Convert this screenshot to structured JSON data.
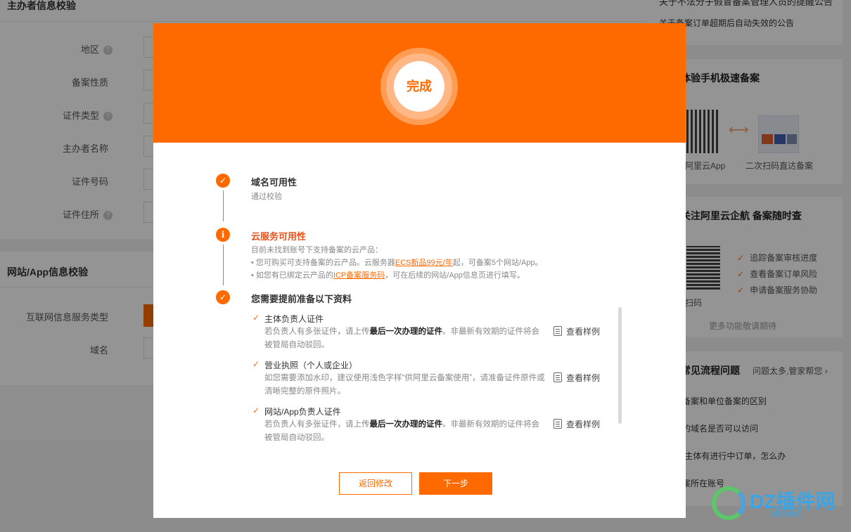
{
  "background": {
    "section1_title": "主办者信息校验",
    "fields1": [
      {
        "label": "地区",
        "has_help": true
      },
      {
        "label": "备案性质",
        "has_help": false
      },
      {
        "label": "证件类型",
        "has_help": true
      },
      {
        "label": "主办者名称",
        "has_help": false
      },
      {
        "label": "证件号码",
        "has_help": false
      },
      {
        "label": "证件住所",
        "has_help": true
      }
    ],
    "section2_title": "网站/App信息校验",
    "fields2": [
      {
        "label": "互联网信息服务类型"
      },
      {
        "label": "域名"
      }
    ],
    "help_glyph": "?"
  },
  "sidebar": {
    "notice_top": "关于不法分子假冒备案管理人员的提醒公告",
    "notice": "关于备案订单超期后自动失效的公告",
    "mobile_title": "体验手机极速备案",
    "mobile_caption_left": "阿里云App",
    "mobile_caption_right": "二次扫码直达备案",
    "follow_title": "关注阿里云企航 备案随时查",
    "follow_items": [
      "追踪备案审核进度",
      "查看备案订单风险",
      "申请备案服务协助"
    ],
    "follow_caption": "扫码",
    "follow_more": "更多功能敬请期待",
    "faq_title": "常见流程问题",
    "faq_more": "问题太多,管家帮您",
    "faq_items": [
      "个人备案和单位备案的区别",
      "备案的域名是否可以访问",
      "证件/主体有进行中订单，怎么办",
      "找备案所在账号"
    ]
  },
  "modal": {
    "status": "完成",
    "steps": [
      {
        "icon": "✓",
        "title": "域名可用性",
        "desc": [
          "通过校验"
        ]
      },
      {
        "icon": "i",
        "title": "云服务可用性",
        "desc_intro": "目前未找到账号下支持备案的云产品：",
        "line1_a": "• 您可购买可支持备案的云产品。云服务器",
        "line1_link": "ECS新品99元/年",
        "line1_b": "起，可备案5个网站/App。",
        "line2_a": "• 如您有已绑定云产品的",
        "line2_link": "ICP备案服务码",
        "line2_b": "，可在后续的网站/App信息页进行填写。"
      },
      {
        "icon": "✓",
        "title": "您需要提前准备以下资料"
      }
    ],
    "docs": [
      {
        "title": "主体负责人证件",
        "desc_a": "若负责人有多张证件，请上传",
        "desc_bold": "最后一次办理的证件",
        "desc_b": "。非最新有效期的证件将会被管局自动驳回。",
        "sample": "查看样例"
      },
      {
        "title": "营业执照（个人或企业）",
        "desc_a": "如您需要添加水印，建议使用浅色字样“供阿里云备案使用”，请准备证件原件或清晰完整的原件照片。",
        "desc_bold": "",
        "desc_b": "",
        "sample": "查看样例"
      },
      {
        "title": "网站/App负责人证件",
        "desc_a": "若负责人有多张证件，请上传",
        "desc_bold": "最后一次办理的证件",
        "desc_b": "。非最新有效期的证件将会被管局自动驳回。",
        "sample": "查看样例"
      }
    ],
    "check_glyph": "✓",
    "back_label": "返回修改",
    "next_label": "下一步"
  },
  "watermark": {
    "text": "DZ插件网",
    "sub": "dz-x.net"
  },
  "colors": {
    "accent": "#ff6a00",
    "warn": "#e8541e"
  }
}
